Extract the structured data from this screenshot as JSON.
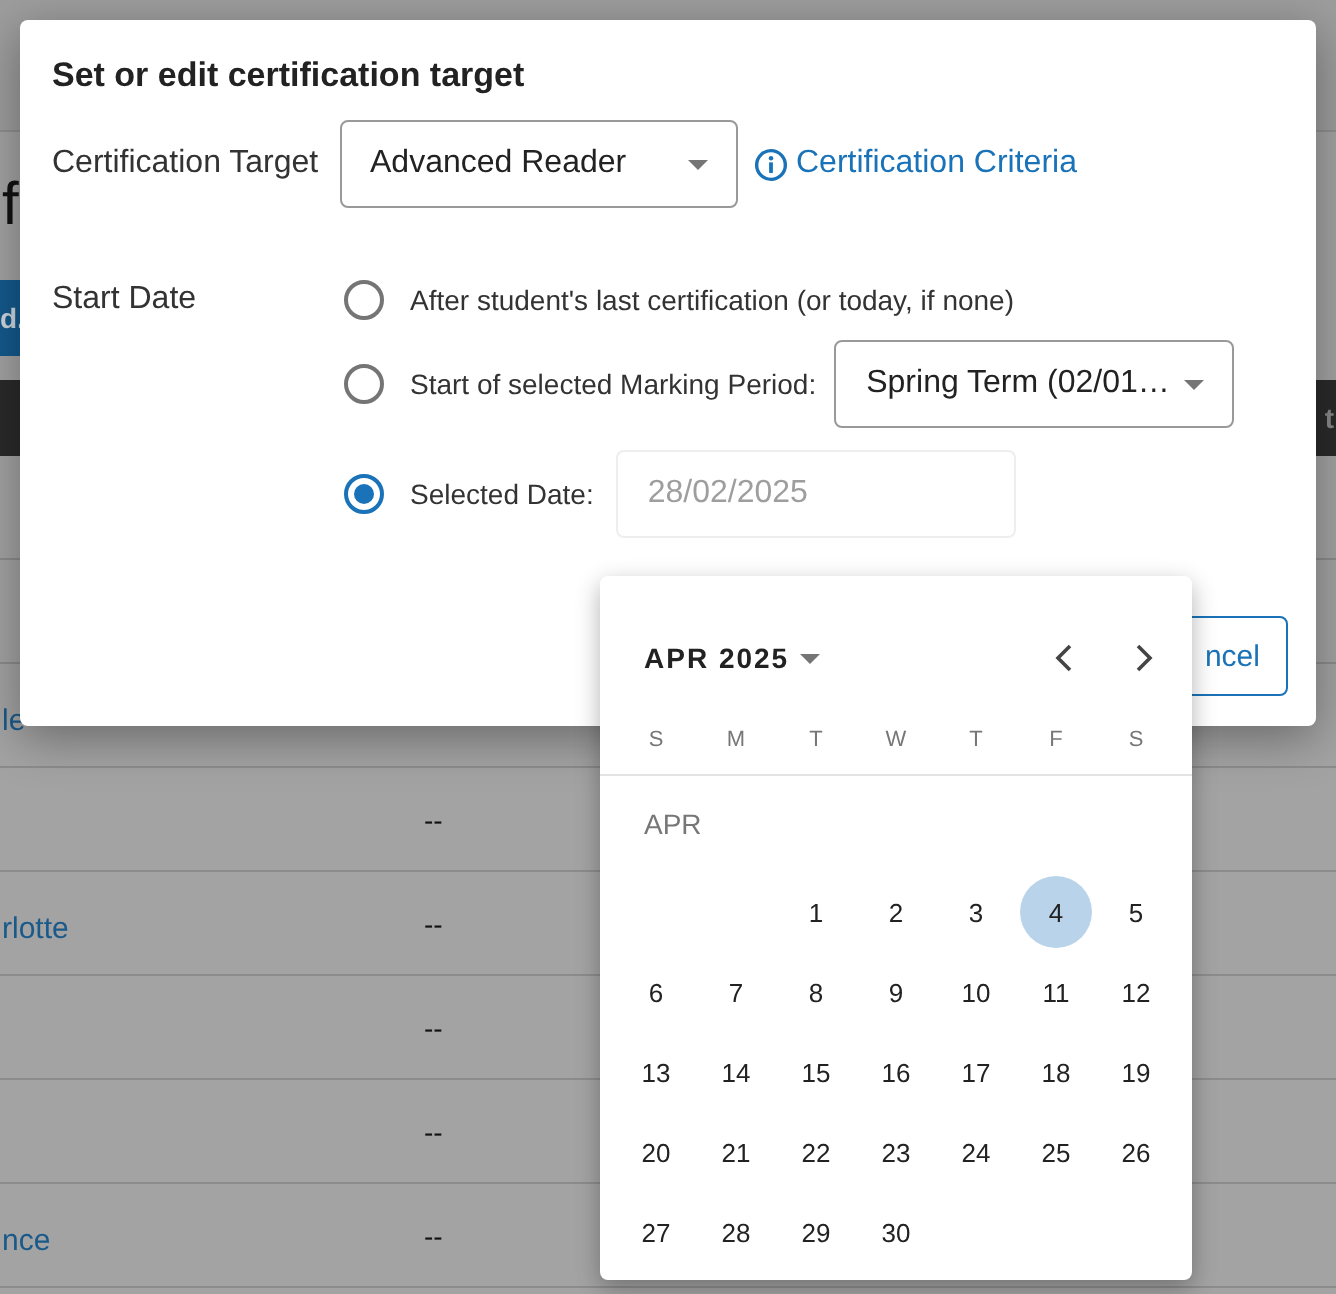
{
  "background": {
    "heading": "f",
    "button": "d.",
    "bar_text": "t",
    "rows": [
      {
        "name": "le"
      },
      {
        "value": "--"
      },
      {
        "name": "rlotte",
        "value": "--"
      },
      {
        "value": "--"
      },
      {
        "value": "--"
      },
      {
        "name": "nce",
        "value": "--"
      }
    ]
  },
  "dialog": {
    "title": "Set or edit certification target",
    "target_label": "Certification Target",
    "target_value": "Advanced Reader",
    "criteria_link": "Certification Criteria",
    "start_label": "Start Date",
    "options": [
      {
        "kind": "plain",
        "label": "After student's last certification (or today, if none)",
        "selected": false
      },
      {
        "kind": "select",
        "label": "Start of selected Marking Period:",
        "value": "Spring Term (02/01…",
        "selected": false
      },
      {
        "kind": "date",
        "label": "Selected Date:",
        "placeholder": "28/02/2025",
        "selected": true
      }
    ],
    "cancel": "ncel"
  },
  "calendar": {
    "month": "APR 2025",
    "weekdays": [
      "S",
      "M",
      "T",
      "W",
      "T",
      "F",
      "S"
    ],
    "month_label": "APR",
    "weeks": [
      {
        "days": [
          {
            "day": "1",
            "highlighted": false
          },
          {
            "day": "2",
            "highlighted": false
          },
          {
            "day": "3",
            "highlighted": false
          },
          {
            "day": "4",
            "highlighted": true
          },
          {
            "day": "5",
            "highlighted": false
          }
        ]
      },
      {
        "days": [
          {
            "day": "6",
            "highlighted": false
          },
          {
            "day": "7",
            "highlighted": false
          },
          {
            "day": "8",
            "highlighted": false
          },
          {
            "day": "9",
            "highlighted": false
          },
          {
            "day": "10",
            "highlighted": false
          },
          {
            "day": "11",
            "highlighted": false
          },
          {
            "day": "12",
            "highlighted": false
          }
        ]
      },
      {
        "days": [
          {
            "day": "13",
            "highlighted": false
          },
          {
            "day": "14",
            "highlighted": false
          },
          {
            "day": "15",
            "highlighted": false
          },
          {
            "day": "16",
            "highlighted": false
          },
          {
            "day": "17",
            "highlighted": false
          },
          {
            "day": "18",
            "highlighted": false
          },
          {
            "day": "19",
            "highlighted": false
          }
        ]
      },
      {
        "days": [
          {
            "day": "20",
            "highlighted": false
          },
          {
            "day": "21",
            "highlighted": false
          },
          {
            "day": "22",
            "highlighted": false
          },
          {
            "day": "23",
            "highlighted": false
          },
          {
            "day": "24",
            "highlighted": false
          },
          {
            "day": "25",
            "highlighted": false
          },
          {
            "day": "26",
            "highlighted": false
          }
        ]
      },
      {
        "days": [
          {
            "day": "27",
            "highlighted": false
          },
          {
            "day": "28",
            "highlighted": false
          },
          {
            "day": "29",
            "highlighted": false
          },
          {
            "day": "30",
            "highlighted": false
          }
        ]
      }
    ]
  }
}
